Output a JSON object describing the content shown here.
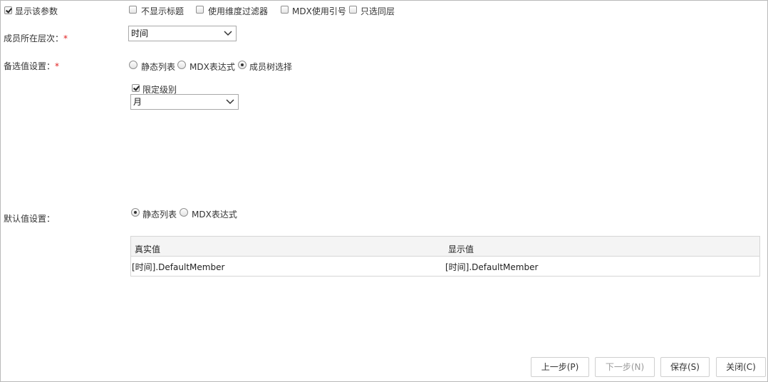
{
  "show_param": {
    "label": "显示该参数",
    "checked": true
  },
  "options": [
    {
      "label": "不显示标题",
      "checked": false
    },
    {
      "label": "使用维度过滤器",
      "checked": false
    },
    {
      "label": "MDX使用引号",
      "checked": false
    },
    {
      "label": "只选同层",
      "checked": false
    }
  ],
  "level": {
    "label": "成员所在层次：",
    "required_mark": "*",
    "value": "时间"
  },
  "candidate": {
    "label": "备选值设置：",
    "required_mark": "*",
    "options": [
      {
        "label": "静态列表",
        "selected": false
      },
      {
        "label": "MDX表达式",
        "selected": false
      },
      {
        "label": "成员树选择",
        "selected": true
      }
    ],
    "limit_level": {
      "label": "限定级别",
      "checked": true
    },
    "level_select_value": "月"
  },
  "default": {
    "label": "默认值设置：",
    "options": [
      {
        "label": "静态列表",
        "selected": true
      },
      {
        "label": "MDX表达式",
        "selected": false
      }
    ],
    "table": {
      "columns": [
        "真实值",
        "显示值"
      ],
      "rows": [
        [
          "[时间].DefaultMember",
          "[时间].DefaultMember"
        ]
      ]
    }
  },
  "buttons": {
    "prev": "上一步(P)",
    "next": "下一步(N)",
    "save": "保存(S)",
    "close": "关闭(C)"
  }
}
